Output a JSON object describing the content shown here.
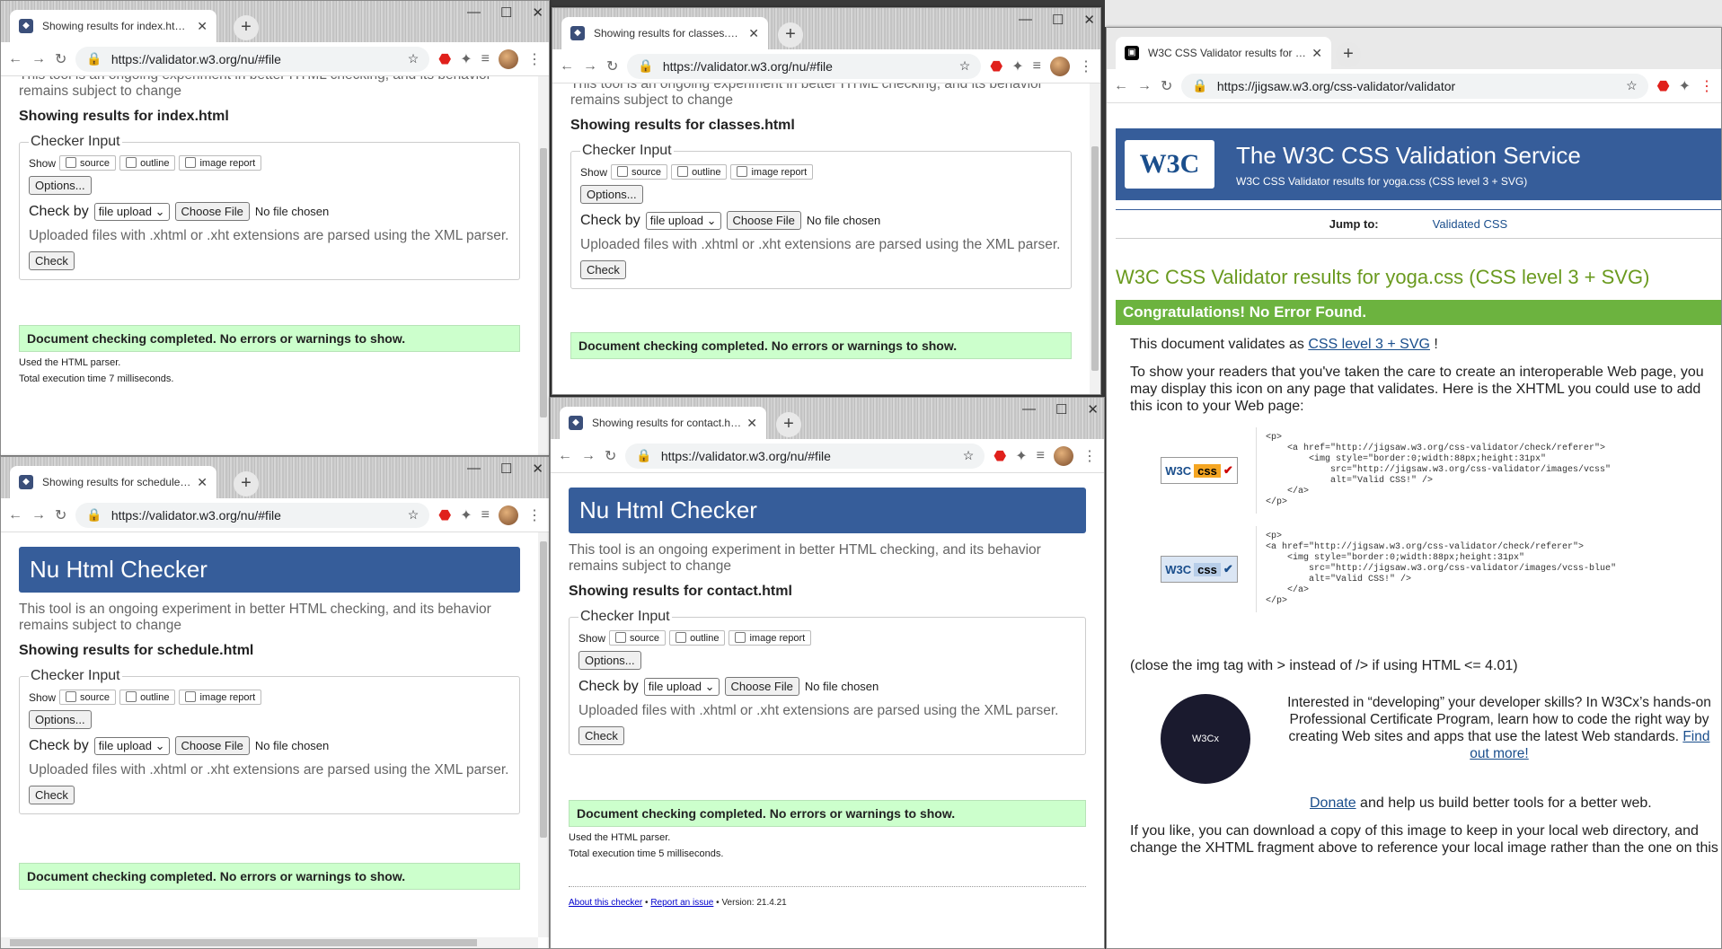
{
  "common": {
    "header_title": "Nu Html Checker",
    "intro": "This tool is an ongoing experiment in better HTML checking, and its behavior remains subject to change",
    "legend": "Checker Input",
    "show_label": "Show",
    "cb_source": "source",
    "cb_outline": "outline",
    "cb_image": "image report",
    "options_btn": "Options...",
    "checkby_label": "Check by",
    "checkby_value": "file upload",
    "choose_file": "Choose File",
    "no_file": "No file chosen",
    "uploaded_note": "Uploaded files with .xhtml or .xht extensions are parsed using the XML parser.",
    "check_btn": "Check",
    "done_msg": "Document checking completed. No errors or warnings to show.",
    "parser_note": "Used the HTML parser.",
    "url": "https://validator.w3.org/nu/#file",
    "new_tab": "+",
    "close": "✕",
    "min": "—",
    "max": "☐"
  },
  "win_index": {
    "tab": "Showing results for index.html -",
    "showing": "Showing results for index.html",
    "exec": "Total execution time 7 milliseconds."
  },
  "win_classes": {
    "tab": "Showing results for classes.html",
    "showing": "Showing results for classes.html"
  },
  "win_schedule": {
    "tab": "Showing results for schedule.htm",
    "showing": "Showing results for schedule.html"
  },
  "win_contact": {
    "tab": "Showing results for contact.html",
    "showing": "Showing results for contact.html",
    "exec": "Total execution time 5 milliseconds.",
    "footer_about": "About this checker",
    "footer_issue": "Report an issue",
    "footer_version": "Version: 21.4.21"
  },
  "win_css": {
    "tab": "W3C CSS Validator results for yo",
    "url": "https://jigsaw.w3.org/css-validator/validator",
    "logo": "W3C",
    "title": "The W3C CSS Validation Service",
    "subtitle": "W3C CSS Validator results for yoga.css (CSS level 3 + SVG)",
    "jump_label": "Jump to:",
    "jump_link": "Validated CSS",
    "result_heading": "W3C CSS Validator results for yoga.css (CSS level 3 + SVG)",
    "congrats": "Congratulations! No Error Found.",
    "validates_prefix": "This document validates as",
    "validates_link": "CSS level 3 + SVG",
    "validates_suffix": "!",
    "show_readers": "To show your readers that you've taken the care to create an interoperable Web page, you may display this icon on any page that validates. Here is the XHTML you could use to add this icon to your Web page:",
    "badge_text": "css",
    "code1": "<p>\n    <a href=\"http://jigsaw.w3.org/css-validator/check/referer\">\n        <img style=\"border:0;width:88px;height:31px\"\n            src=\"http://jigsaw.w3.org/css-validator/images/vcss\"\n            alt=\"Valid CSS!\" />\n    </a>\n</p>",
    "code2": "<p>\n<a href=\"http://jigsaw.w3.org/css-validator/check/referer\">\n    <img style=\"border:0;width:88px;height:31px\"\n        src=\"http://jigsaw.w3.org/css-validator/images/vcss-blue\"\n        alt=\"Valid CSS!\" />\n    </a>\n</p>",
    "close_note": "(close the img tag with > instead of /> if using HTML <= 4.01)",
    "promo": "Interested in “developing” your developer skills? In W3Cx’s hands-on Professional Certificate Program, learn how to code the right way by creating Web sites and apps that use the latest Web standards.",
    "promo_link": "Find out more!",
    "promo_logo": "W3Cx",
    "donate_link": "Donate",
    "donate_text": "and help us build better tools for a better web.",
    "download": "If you like, you can download a copy of this image to keep in your local web directory, and change the XHTML fragment above to reference your local image rather than the one on this"
  }
}
